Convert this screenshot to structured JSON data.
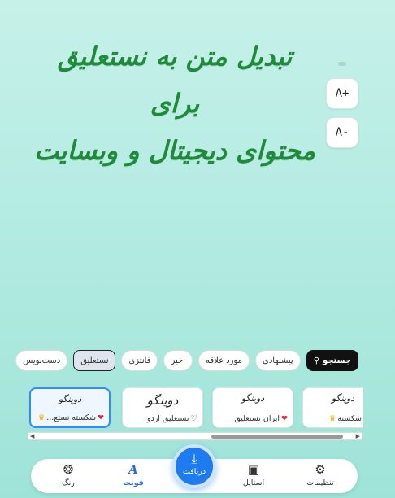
{
  "preview": {
    "line1": "تبدیل متن به نستعلیق برای",
    "line2": "محتوای دیجیتال و وبسایت",
    "color": "#1f8a3a"
  },
  "size_controls": {
    "increase": "A+",
    "decrease": "A-"
  },
  "filter_chips": [
    {
      "label": "جستجو",
      "icon": "search-icon",
      "style": "search"
    },
    {
      "label": "پیشنهادی"
    },
    {
      "label": "مورد علاقه"
    },
    {
      "label": "اخیر"
    },
    {
      "label": "فانتزی"
    },
    {
      "label": "نستعلیق",
      "selected": true
    },
    {
      "label": "دست‌نویس"
    }
  ],
  "font_cards": [
    {
      "glyph": "دوینگو",
      "name": "شکسته نستع...",
      "badge_icons": [
        "heart-icon",
        "crown-icon"
      ],
      "active": true
    },
    {
      "glyph": "دوینگو",
      "name": "نستعلیق اردو",
      "badge_icons": [
        "heart-outline-icon"
      ]
    },
    {
      "glyph": "دوینگو",
      "name": "ایران نستعلیق",
      "badge_icons": [
        "heart-icon"
      ]
    },
    {
      "glyph": "دوینگو",
      "name": "...ما شکسته",
      "badge_icons": [
        "crown-icon"
      ]
    }
  ],
  "bottom_nav": {
    "color": "رنگ",
    "font": "فونت",
    "download": "دریافت",
    "style": "استایل",
    "settings": "تنظیمات"
  },
  "colors": {
    "accent": "#1e7bf0",
    "active_nav": "#2f6fd8"
  }
}
